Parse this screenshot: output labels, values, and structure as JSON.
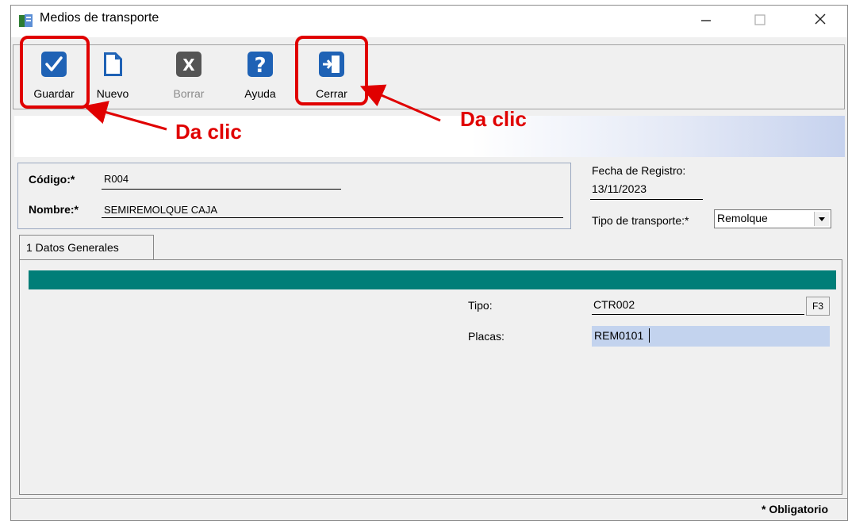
{
  "window": {
    "title": "Medios de transporte",
    "minimize": "—",
    "maximize": "☐",
    "close": "✕"
  },
  "toolbar": {
    "buttons": [
      {
        "label": "Guardar",
        "icon": "checkmark-icon",
        "enabled": true
      },
      {
        "label": "Nuevo",
        "icon": "new-document-icon",
        "enabled": true
      },
      {
        "label": "Borrar",
        "icon": "delete-x-icon",
        "enabled": false
      },
      {
        "label": "Ayuda",
        "icon": "help-question-icon",
        "enabled": true
      },
      {
        "label": "Cerrar",
        "icon": "exit-door-icon",
        "enabled": true
      }
    ]
  },
  "form": {
    "codigo_label": "Código:*",
    "codigo_value": "R004",
    "nombre_label": "Nombre:*",
    "nombre_value": "SEMIREMOLQUE CAJA",
    "fecha_label": "Fecha de Registro:",
    "fecha_value": "13/11/2023",
    "tipo_transporte_label": "Tipo de transporte:*",
    "tipo_transporte_value": "Remolque"
  },
  "tabs": [
    {
      "label": "1 Datos Generales",
      "active": true
    }
  ],
  "datos_generales": {
    "tipo_label": "Tipo:",
    "tipo_value": "CTR002",
    "tipo_lookup_button": "F3",
    "placas_label": "Placas:",
    "placas_value": "REM0101"
  },
  "status": {
    "required_note": "* Obligatorio"
  },
  "annotations": {
    "callout_text": "Da clic",
    "color": "#e00000"
  },
  "colors": {
    "teal_bar": "#007e78",
    "highlight_input": "#c3d3ee",
    "icon_blue": "#1f62b5",
    "icon_gray": "#555555"
  }
}
